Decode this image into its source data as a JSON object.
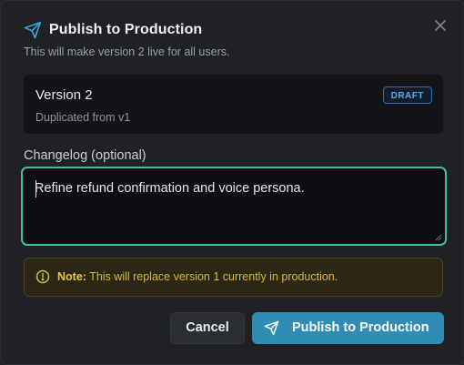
{
  "dialog": {
    "title": "Publish to Production",
    "subtitle": "This will make version 2 live for all users.",
    "header_icon": "send-icon",
    "close_icon": "close-icon"
  },
  "version_card": {
    "name": "Version 2",
    "source": "Duplicated from v1",
    "badge": "DRAFT"
  },
  "changelog": {
    "label": "Changelog (optional)",
    "value": "Refine refund confirmation and voice persona."
  },
  "note": {
    "icon": "warning-icon",
    "prefix": "Note:",
    "text": " This will replace version 1 currently in production."
  },
  "actions": {
    "cancel_label": "Cancel",
    "publish_label": "Publish to Production",
    "publish_icon": "send-icon"
  },
  "colors": {
    "accent": "#2e8cb5",
    "focus_border": "#3fc1a0",
    "badge": "#5ea8f0",
    "warning_text": "#d8b83a"
  }
}
